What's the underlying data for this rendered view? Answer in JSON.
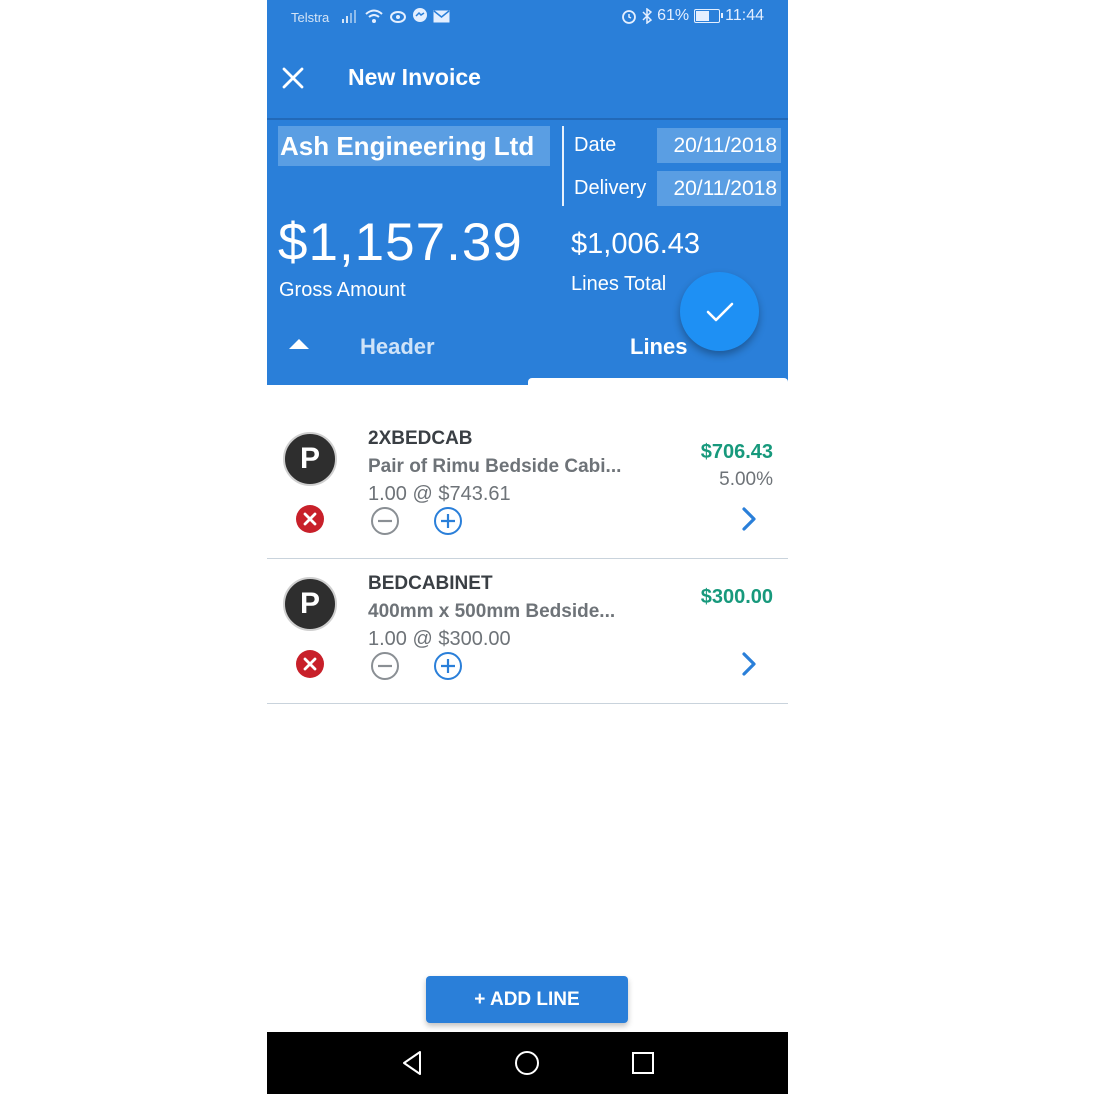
{
  "status_bar": {
    "carrier": "Telstra",
    "battery": "61%",
    "time": "11:44",
    "icons": [
      "signal-icon",
      "wifi-icon",
      "eye-icon",
      "messenger-icon",
      "mail-icon",
      "alarm-icon",
      "bluetooth-icon",
      "battery-icon"
    ]
  },
  "app_bar": {
    "title": "New Invoice",
    "close_icon": "close-icon"
  },
  "invoice_header": {
    "customer": "Ash Engineering Ltd",
    "date_label": "Date",
    "date_value": "20/11/2018",
    "delivery_label": "Delivery",
    "delivery_value": "20/11/2018",
    "gross_amount": "$1,157.39",
    "gross_label": "Gross Amount",
    "lines_total": "$1,006.43",
    "lines_total_label": "Lines Total"
  },
  "tabs": [
    {
      "label": "Header",
      "active": false
    },
    {
      "label": "Lines",
      "active": true
    }
  ],
  "lines": [
    {
      "avatar": "P",
      "code": "2XBEDCAB",
      "description": "Pair of Rimu Bedside Cabi...",
      "qty_price": "1.00 @ $743.61",
      "amount": "$706.43",
      "discount": "5.00%"
    },
    {
      "avatar": "P",
      "code": "BEDCABINET",
      "description": "400mm x 500mm Bedside...",
      "qty_price": "1.00 @ $300.00",
      "amount": "$300.00",
      "discount": ""
    }
  ],
  "add_line_label": "+ ADD LINE",
  "colors": {
    "primary": "#2a7fd9",
    "fab": "#1e90f4",
    "amount_green": "#17997c",
    "delete_red": "#c8202a",
    "plus_blue": "#2a7fd9"
  }
}
